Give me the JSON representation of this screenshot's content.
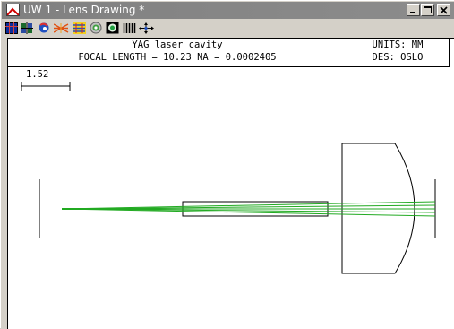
{
  "window": {
    "title": "UW 1 - Lens Drawing *",
    "controls": {
      "minimize": "minimize",
      "maximize": "maximize",
      "close": "close"
    }
  },
  "toolbar": {
    "buttons": [
      {
        "icon": "grid-layout-icon"
      },
      {
        "icon": "lens-array-icon"
      },
      {
        "icon": "rotate-view-icon"
      },
      {
        "icon": "ray-fan-icon"
      },
      {
        "icon": "spot-diagram-icon"
      },
      {
        "icon": "aperture-icon"
      },
      {
        "icon": "image-view-icon"
      },
      {
        "icon": "bars-icon"
      },
      {
        "icon": "move-arrows-icon"
      }
    ]
  },
  "drawing": {
    "header": {
      "title": "YAG laser cavity",
      "focal_length_text": "FOCAL LENGTH = 10.23   NA = 0.0002405",
      "units_text": "UNITS: MM",
      "designer_text": "DES: OSLO"
    },
    "scale_label": "1.52",
    "colors": {
      "rays": "#22aa22",
      "lines": "#000000",
      "background": "#ffffff"
    }
  }
}
